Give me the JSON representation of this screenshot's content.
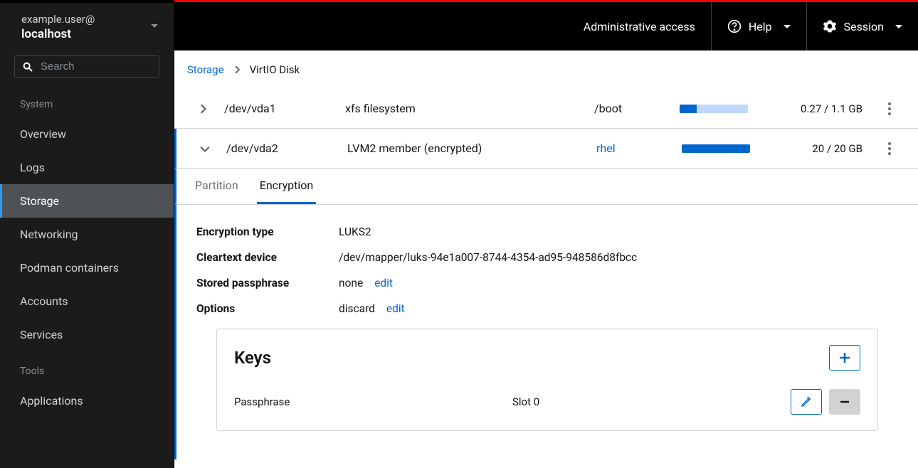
{
  "sidebar": {
    "user": "example.user@",
    "host": "localhost",
    "search_placeholder": "Search",
    "section_system": "System",
    "section_tools": "Tools",
    "items": {
      "overview": "Overview",
      "logs": "Logs",
      "storage": "Storage",
      "networking": "Networking",
      "podman": "Podman containers",
      "accounts": "Accounts",
      "services": "Services",
      "applications": "Applications"
    }
  },
  "topbar": {
    "admin": "Administrative access",
    "help": "Help",
    "session": "Session"
  },
  "breadcrumb": {
    "root": "Storage",
    "current": "VirtIO Disk"
  },
  "partitions": [
    {
      "device": "/dev/vda1",
      "fs": "xfs filesystem",
      "mount": "/boot",
      "mount_is_link": false,
      "usage_label": "0.27 / 1.1 GB",
      "usage_pct": 25,
      "expanded": false
    },
    {
      "device": "/dev/vda2",
      "fs": "LVM2 member (encrypted)",
      "mount": "rhel",
      "mount_is_link": true,
      "usage_label": "20 / 20 GB",
      "usage_pct": 100,
      "expanded": true
    }
  ],
  "tabs": {
    "partition": "Partition",
    "encryption": "Encryption"
  },
  "details": {
    "encryption_type": {
      "label": "Encryption type",
      "value": "LUKS2"
    },
    "cleartext_device": {
      "label": "Cleartext device",
      "value": "/dev/mapper/luks-94e1a007-8744-4354-ad95-948586d8fbcc"
    },
    "stored_passphrase": {
      "label": "Stored passphrase",
      "value": "none",
      "edit": "edit"
    },
    "options": {
      "label": "Options",
      "value": "discard",
      "edit": "edit"
    }
  },
  "keys": {
    "title": "Keys",
    "row": {
      "type": "Passphrase",
      "slot": "Slot 0"
    }
  }
}
